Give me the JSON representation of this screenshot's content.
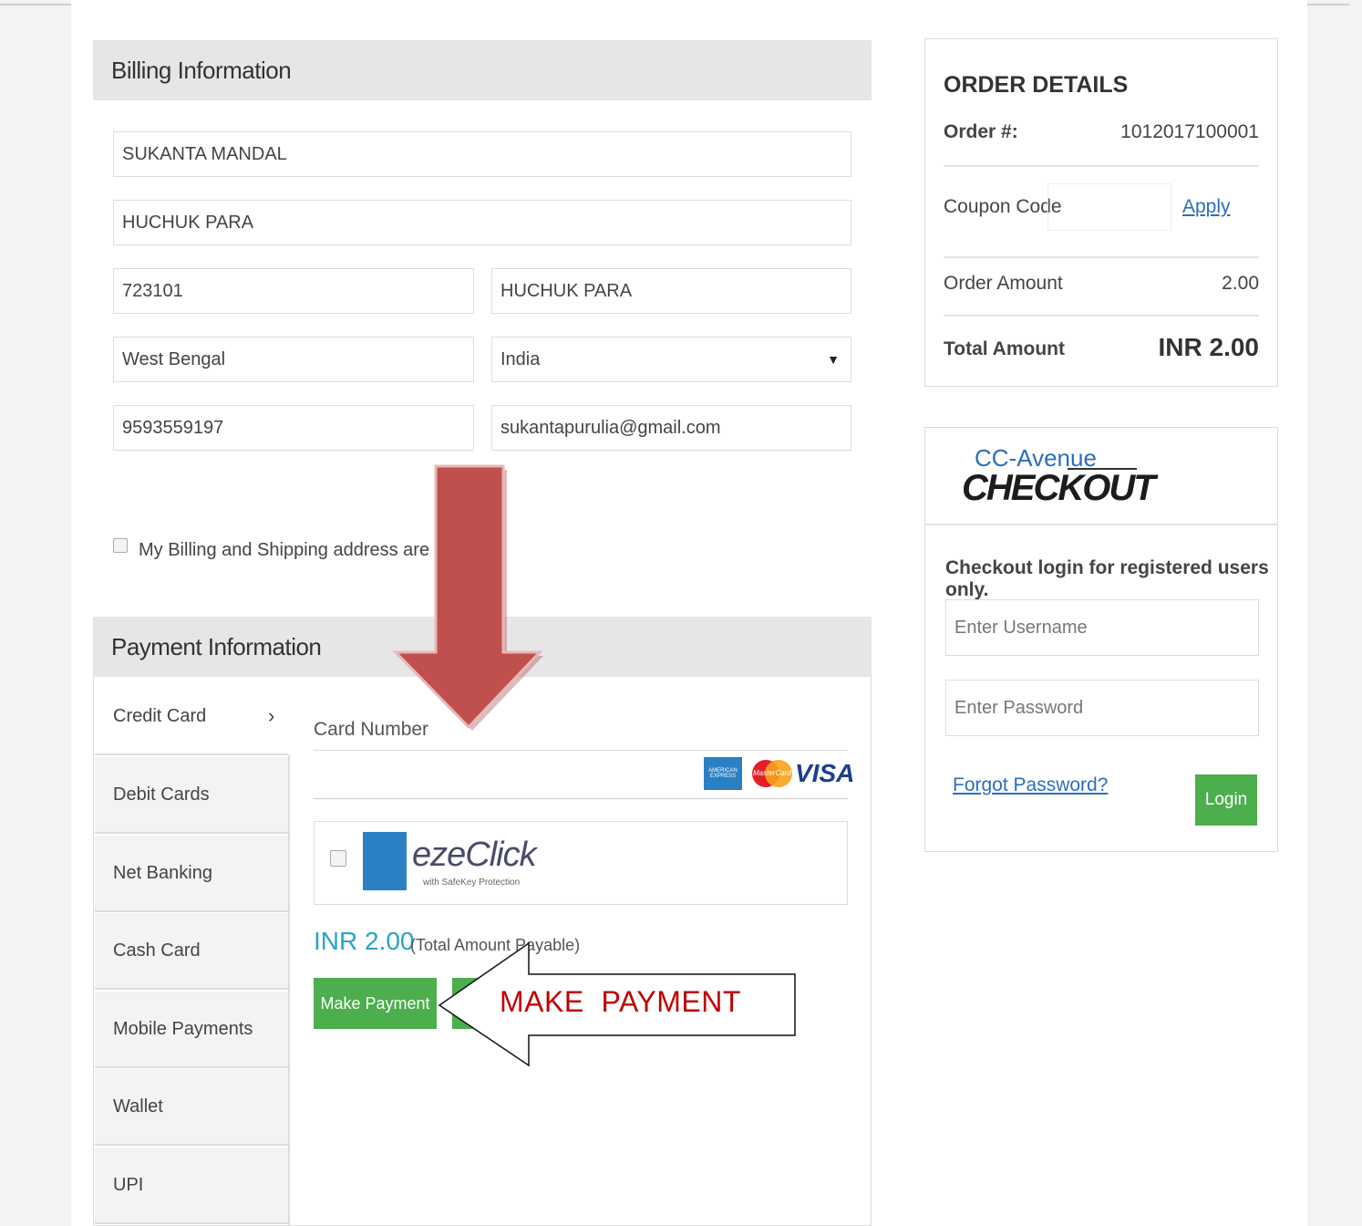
{
  "billing": {
    "title": "Billing Information",
    "name": "SUKANTA MANDAL",
    "address": "HUCHUK PARA",
    "zip": "723101",
    "city": "HUCHUK PARA",
    "state": "West Bengal",
    "country": "India",
    "phone": "9593559197",
    "email": "sukantapurulia@gmail.com",
    "shipping_checkbox_label": "My Billing and Shipping address are diffe"
  },
  "payment": {
    "title": "Payment Information",
    "tabs": [
      "Credit Card",
      "Debit Cards",
      "Net Banking",
      "Cash Card",
      "Mobile Payments",
      "Wallet",
      "UPI"
    ],
    "tab_chevron": "›",
    "card_number_label": "Card Number",
    "card_logos": [
      "AMERICAN EXPRESS",
      "MasterCard",
      "VISA"
    ],
    "ezeclick_brand": "ezeClick",
    "ezeclick_sub": "with SafeKey Protection",
    "amount": "INR 2.00",
    "amount_note": "(Total Amount Payable)",
    "make_payment": "Make Payment"
  },
  "order": {
    "title": "ORDER DETAILS",
    "order_no_label": "Order #:",
    "order_no": "1012017100001",
    "coupon_label": "Coupon Code",
    "apply": "Apply",
    "order_amount_label": "Order Amount",
    "order_amount": "2.00",
    "total_label": "Total Amount",
    "total": "INR 2.00"
  },
  "checkout": {
    "brand_top": "CC-Avenue",
    "brand_bottom": "CHECKOUT",
    "note": "Checkout login for registered users only.",
    "username_placeholder": "Enter Username",
    "password_placeholder": "Enter Password",
    "forgot": "Forgot Password?",
    "login": "Login"
  },
  "annotation": {
    "callout": "MAKE  PAYMENT",
    "arrow_color": "#c0504d"
  }
}
